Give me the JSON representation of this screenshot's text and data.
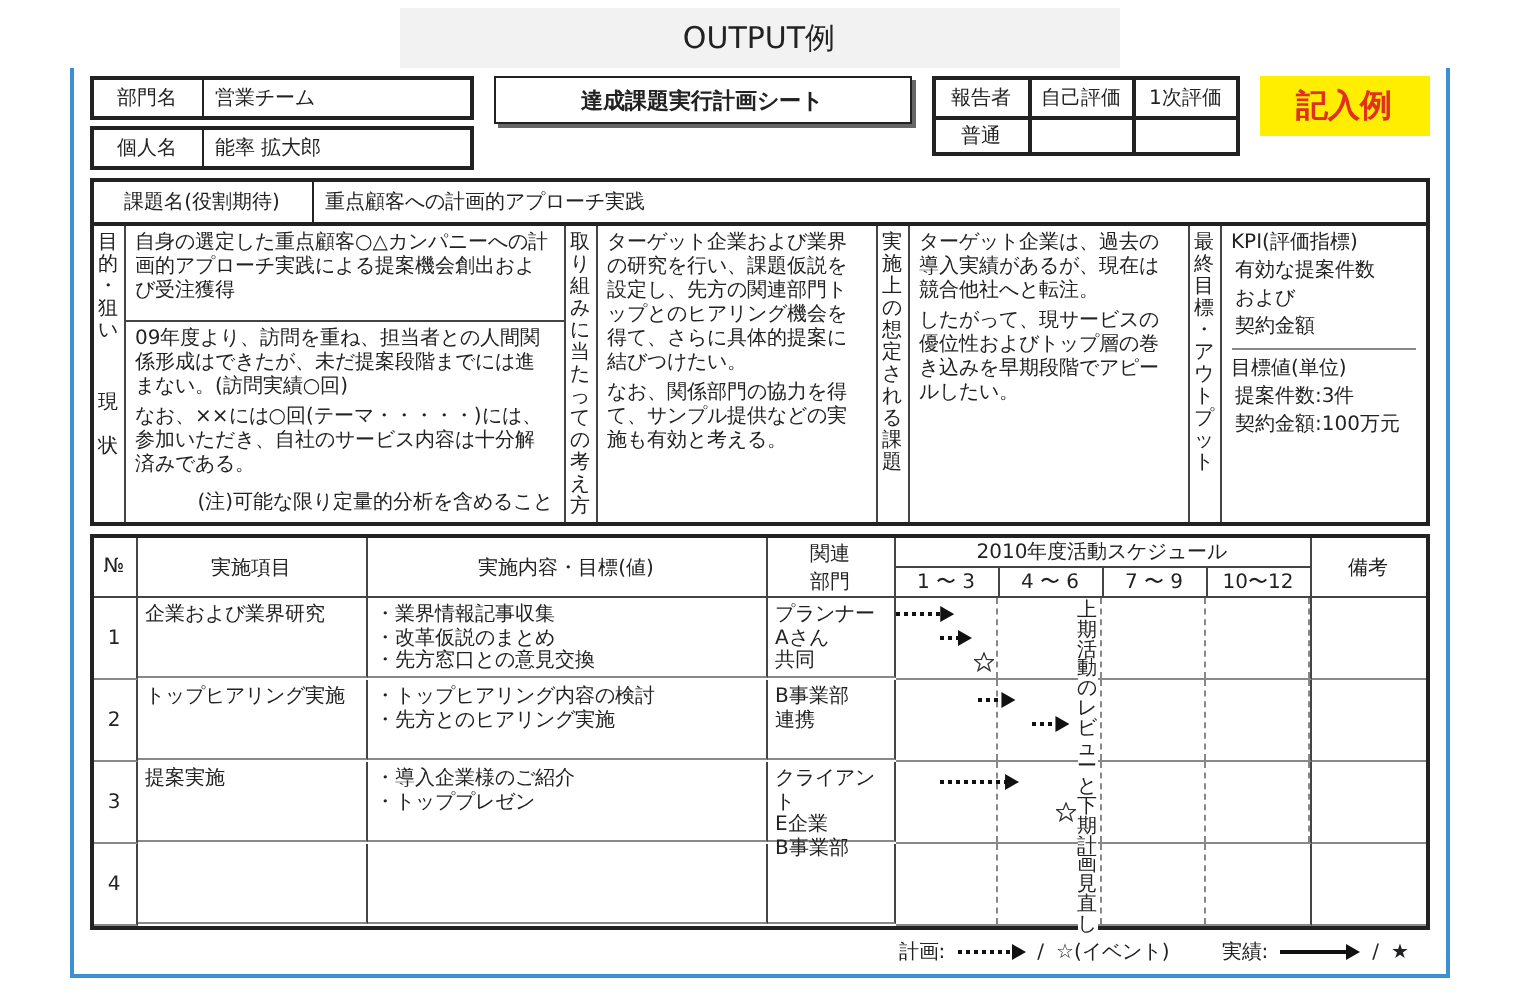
{
  "page_title": "OUTPUT例",
  "header": {
    "fields": [
      {
        "label": "部門名",
        "value": "営業チーム"
      },
      {
        "label": "個人名",
        "value": "能率 拡大郎"
      }
    ],
    "sheet_title": "達成課題実行計画シート",
    "evaluation": {
      "rows": [
        [
          "報告者",
          "自己評価",
          "1次評価"
        ],
        [
          "普通"
        ]
      ]
    },
    "stamp": "記入例"
  },
  "theme": {
    "label": "課題名(役割期待)",
    "value": "重点顧客への計画的アプローチ実践"
  },
  "purpose": {
    "label": "目的・狙い",
    "text": "自身の選定した重点顧客○△カンパニーへの計画的アプローチ実践による提案機会創出および受注獲得"
  },
  "status": {
    "label": "現状",
    "paragraphs": [
      "09年度より、訪問を重ね、担当者との人間関係形成はできたが、未だ提案段階までには進まない。(訪問実績○回)",
      "なお、××には○回(テーマ・・・・・)には、参加いただき、自社のサービス内容は十分解済みである。"
    ],
    "note": "(注)可能な限り定量的分析を含めること"
  },
  "approach": {
    "label": "取り組みに当たっての考え方",
    "paragraphs": [
      "ターゲット企業および業界の研究を行い、課題仮説を設定し、先方の関連部門トップとのヒアリング機会を得て、さらに具体的提案に結びつけたい。",
      "なお、関係部門の協力を得て、サンプル提供などの実施も有効と考える。"
    ]
  },
  "issues": {
    "label": "実施上の想定される課題",
    "paragraphs": [
      "ターゲット企業は、過去の導入実績があるが、現在は競合他社へと転注。",
      "したがって、現サービスの優位性およびトップ層の巻き込みを早期段階でアピールしたい。"
    ]
  },
  "goal": {
    "label": "最終目標・アウトプット",
    "kpi_heading": "KPI(評価指標)",
    "kpi": [
      "有効な提案件数",
      "および",
      "契約金額"
    ],
    "target_heading": "目標値(単位)",
    "targets": [
      "提案件数:3件",
      "契約金額:100万元"
    ]
  },
  "table": {
    "columns": [
      "№",
      "実施項目",
      "実施内容・目標(値)",
      "関連部門"
    ],
    "schedule_title": "2010年度活動スケジュール",
    "quarters": [
      "1 〜 3",
      "4 〜 6",
      "7 〜 9",
      "10〜12"
    ],
    "remarks": "備考",
    "review_note": "上期活動のレビューと下期計画見直し",
    "rows": [
      {
        "no": "1",
        "item": "企業および業界研究",
        "actions": [
          "・業界情報記事収集",
          "・改革仮説のまとめ",
          "・先方窓口との意見交換"
        ],
        "depts": [
          "プランナー",
          "Aさん",
          "共同"
        ],
        "marks": [
          {
            "kind": "plan"
          },
          {
            "kind": "plan"
          },
          {
            "kind": "event"
          }
        ]
      },
      {
        "no": "2",
        "item": "トップヒアリング実施",
        "actions": [
          "・トップヒアリング内容の検討",
          "・先方とのヒアリング実施"
        ],
        "depts": [
          "B事業部",
          "連携"
        ],
        "marks": [
          {
            "kind": "plan"
          },
          {
            "kind": "plan"
          }
        ]
      },
      {
        "no": "3",
        "item": "提案実施",
        "actions": [
          "・導入企業様のご紹介",
          "・トッププレゼン"
        ],
        "depts": [
          "クライアント",
          "E企業",
          "B事業部"
        ],
        "marks": [
          {
            "kind": "plan"
          },
          {
            "kind": "event"
          }
        ]
      },
      {
        "no": "4"
      }
    ]
  },
  "legend": {
    "plan_label": "計画:",
    "separator_1": "/",
    "event": "☆(イベント)",
    "actual_label": "実績:",
    "separator_2": "/",
    "done": "★"
  }
}
